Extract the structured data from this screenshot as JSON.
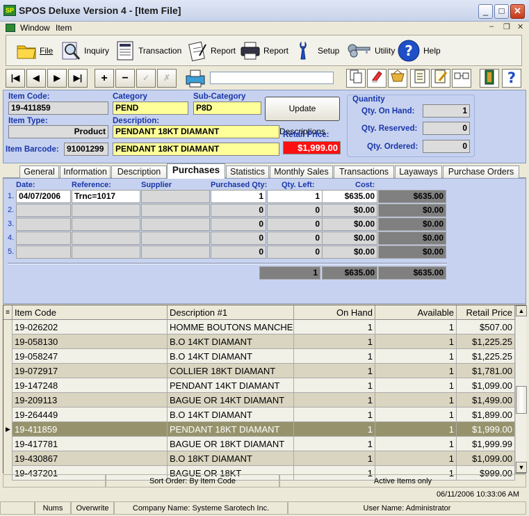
{
  "window": {
    "title": "SPOS Deluxe Version 4 - [Item File]",
    "app_icon_text": "SP"
  },
  "menu": {
    "items": [
      "Window",
      "Item"
    ]
  },
  "toolbar": {
    "buttons": [
      {
        "label": "File",
        "icon": "folder-icon"
      },
      {
        "label": "Inquiry",
        "icon": "magnifier-icon"
      },
      {
        "label": "Transaction",
        "icon": "document-icon"
      },
      {
        "label": "Report",
        "icon": "clipboard-icon"
      },
      {
        "label": "Report",
        "icon": "printer-icon"
      },
      {
        "label": "Setup",
        "icon": "wrench-icon"
      },
      {
        "label": "Utility",
        "icon": "keys-icon"
      },
      {
        "label": "Help",
        "icon": "help-icon"
      }
    ]
  },
  "nav": {
    "first": "|◀",
    "prev": "◀",
    "next": "▶",
    "last": "▶|",
    "add": "+",
    "remove": "−",
    "confirm": "✓",
    "cancel": "✗",
    "search_value": ""
  },
  "item": {
    "code_label": "Item Code:",
    "code": "19-411859",
    "category_label": "Category",
    "category": "PEND",
    "subcategory_label": "Sub-Category",
    "subcategory": "P8D",
    "update_button": "Update Descriptions",
    "type_label": "Item Type:",
    "type": "Product",
    "description_label": "Description:",
    "description1": "PENDANT 18KT DIAMANT",
    "description2": "PENDANT 18KT DIAMANT",
    "barcode_label": "Item Barcode:",
    "barcode": "91001299",
    "price_label": "Retail Price:",
    "price": "$1,999.00"
  },
  "quantity": {
    "title": "Quantity",
    "on_hand_label": "Qty. On Hand:",
    "on_hand": "1",
    "reserved_label": "Qty. Reserved:",
    "reserved": "0",
    "ordered_label": "Qty. Ordered:",
    "ordered": "0"
  },
  "tabs": [
    "General",
    "Information",
    "Description",
    "Purchases",
    "Statistics",
    "Monthly Sales",
    "Transactions",
    "Layaways",
    "Purchase Orders"
  ],
  "active_tab": "Purchases",
  "purchases": {
    "headers": {
      "date": "Date:",
      "reference": "Reference:",
      "supplier": "Supplier",
      "qty": "Purchased Qty:",
      "left": "Qty. Left:",
      "cost": "Cost:"
    },
    "rows": [
      {
        "n": "1.",
        "date": "04/07/2006",
        "reference": "Trnc=1017",
        "supplier": "",
        "qty": "1",
        "left": "1",
        "cost": "$635.00",
        "total": "$635.00"
      },
      {
        "n": "2.",
        "date": "",
        "reference": "",
        "supplier": "",
        "qty": "0",
        "left": "0",
        "cost": "$0.00",
        "total": "$0.00"
      },
      {
        "n": "3.",
        "date": "",
        "reference": "",
        "supplier": "",
        "qty": "0",
        "left": "0",
        "cost": "$0.00",
        "total": "$0.00"
      },
      {
        "n": "4.",
        "date": "",
        "reference": "",
        "supplier": "",
        "qty": "0",
        "left": "0",
        "cost": "$0.00",
        "total": "$0.00"
      },
      {
        "n": "5.",
        "date": "",
        "reference": "",
        "supplier": "",
        "qty": "0",
        "left": "0",
        "cost": "$0.00",
        "total": "$0.00"
      }
    ],
    "totals": {
      "left": "1",
      "cost": "$635.00",
      "total": "$635.00"
    }
  },
  "grid": {
    "columns": [
      "Item Code",
      "Description #1",
      "On Hand",
      "Available",
      "Retail Price"
    ],
    "rows": [
      [
        "19-026202",
        "HOMME BOUTONS MANCHE",
        "1",
        "1",
        "$507.00"
      ],
      [
        "19-058130",
        "B.O 14KT DIAMANT",
        "1",
        "1",
        "$1,225.25"
      ],
      [
        "19-058247",
        "B.O 14KT DIAMANT",
        "1",
        "1",
        "$1,225.25"
      ],
      [
        "19-072917",
        "COLLIER 18KT DIAMANT",
        "1",
        "1",
        "$1,781.00"
      ],
      [
        "19-147248",
        "PENDANT 14KT DIAMANT",
        "1",
        "1",
        "$1,099.00"
      ],
      [
        "19-209113",
        "BAGUE OR 14KT DIAMANT",
        "1",
        "1",
        "$1,499.00"
      ],
      [
        "19-264449",
        "B.O 14KT DIAMANT",
        "1",
        "1",
        "$1,899.00"
      ],
      [
        "19-411859",
        "PENDANT 18KT DIAMANT",
        "1",
        "1",
        "$1,999.00"
      ],
      [
        "19-417781",
        "BAGUE OR 18KT DIAMANT",
        "1",
        "1",
        "$1,999.99"
      ],
      [
        "19-430867",
        "B.O 18KT DIAMANT",
        "1",
        "1",
        "$1,099.00"
      ],
      [
        "19-437201",
        "BAGUE OR 18KT",
        "1",
        "1",
        "$999.00"
      ]
    ],
    "selected_index": 7
  },
  "status": {
    "sort_order": "Sort Order: By Item Code",
    "filter": "Active Items only",
    "datetime": "06/11/2006  10:33:06 AM",
    "nums": "Nums",
    "overwrite": "Overwrite",
    "company": "Company Name: Systeme Sarotech Inc.",
    "user": "User Name: Administrator"
  },
  "colors": {
    "panel": "#c6d2f0",
    "label": "#1a36a8",
    "highlight": "#ffff99",
    "price_bg": "#ff1010",
    "selected_row": "#96936c"
  }
}
